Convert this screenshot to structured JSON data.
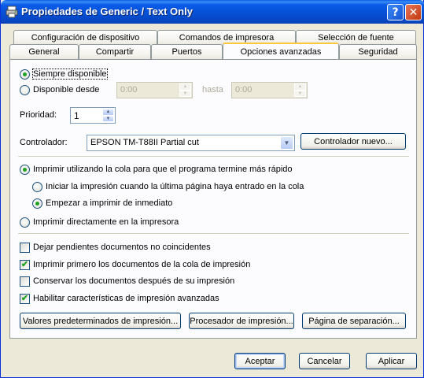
{
  "window": {
    "title": "Propiedades de Generic / Text Only",
    "help_glyph": "?",
    "close_glyph": "✕"
  },
  "tabs_row1": [
    {
      "label": "Configuración de dispositivo"
    },
    {
      "label": "Comandos de impresora"
    },
    {
      "label": "Selección de fuente"
    }
  ],
  "tabs_row2": [
    {
      "label": "General"
    },
    {
      "label": "Compartir"
    },
    {
      "label": "Puertos"
    },
    {
      "label": "Opciones avanzadas",
      "active": true
    },
    {
      "label": "Seguridad"
    }
  ],
  "availability": {
    "always_label": "Siempre disponible",
    "always_selected": true,
    "from_label": "Disponible desde",
    "from_value": "0:00",
    "until_label": "hasta",
    "until_value": "0:00"
  },
  "priority": {
    "label": "Prioridad:",
    "value": "1"
  },
  "driver": {
    "label": "Controlador:",
    "value": "EPSON TM-T88II Partial cut",
    "new_button": "Controlador nuevo..."
  },
  "spooling": {
    "spool_label": "Imprimir utilizando la cola para que el programa termine más rápido",
    "spool_selected": true,
    "start_after_last_label": "Iniciar la impresión cuando la última página haya entrado en la cola",
    "start_immediately_label": "Empezar a imprimir de inmediato",
    "start_immediately_selected": true,
    "direct_label": "Imprimir directamente en la impresora"
  },
  "options": [
    {
      "label": "Dejar pendientes documentos no coincidentes",
      "checked": false
    },
    {
      "label": "Imprimir primero los documentos de la cola de impresión",
      "checked": true
    },
    {
      "label": "Conservar los documentos después de su impresión",
      "checked": false
    },
    {
      "label": "Habilitar características de impresión avanzadas",
      "checked": true
    }
  ],
  "bottom_buttons": {
    "defaults": "Valores predeterminados de impresión...",
    "processor": "Procesador de impresión...",
    "separator": "Página de separación..."
  },
  "dialog_buttons": {
    "ok": "Aceptar",
    "cancel": "Cancelar",
    "apply": "Aplicar"
  },
  "check_glyph": "✔",
  "dropdown_glyph": "▼",
  "spin_up_glyph": "▲",
  "spin_down_glyph": "▼"
}
